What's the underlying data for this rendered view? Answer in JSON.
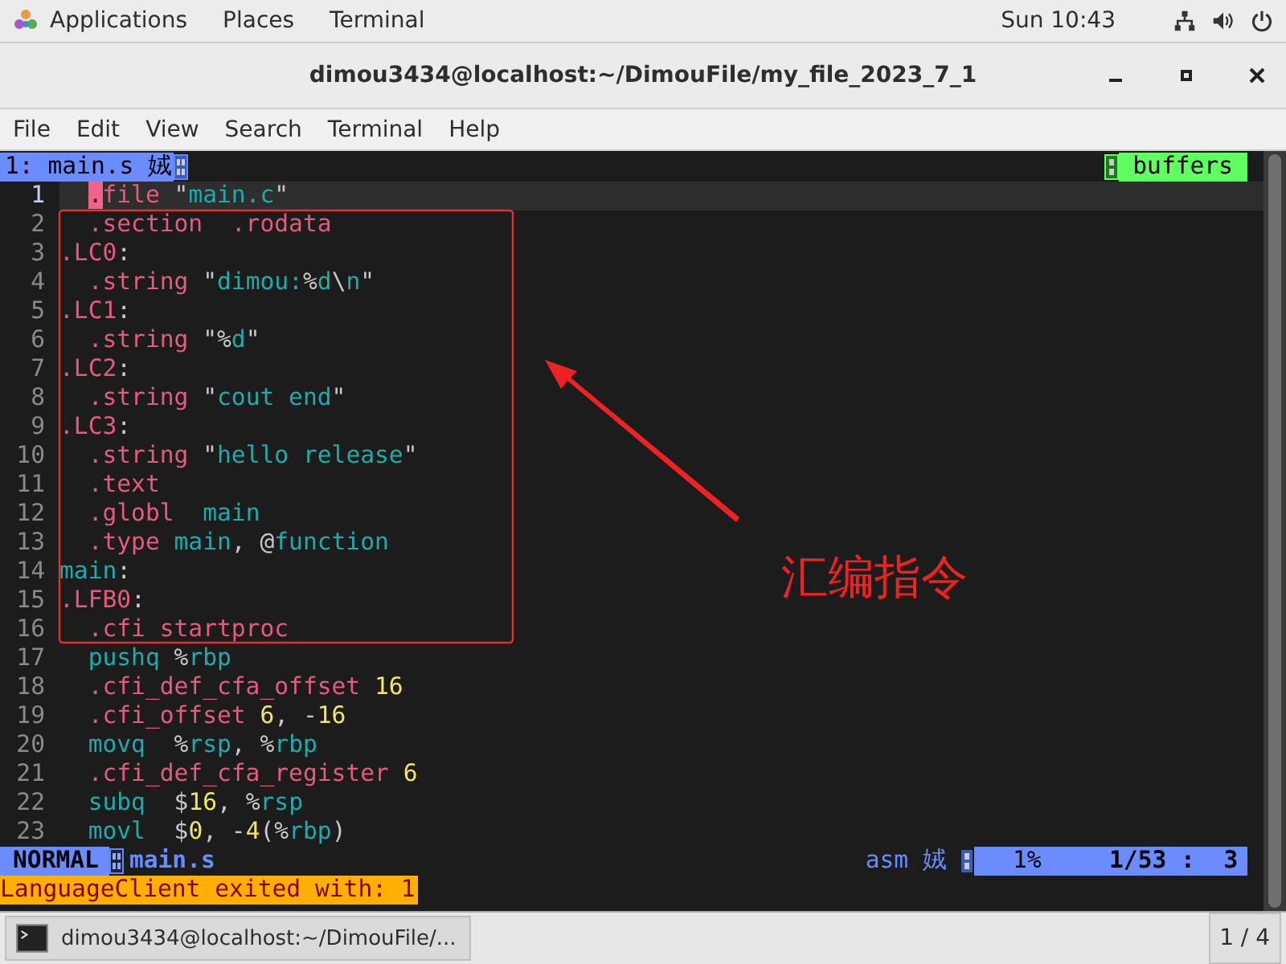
{
  "top_bar": {
    "menus": [
      "Applications",
      "Places",
      "Terminal"
    ],
    "clock": "Sun 10:43"
  },
  "window": {
    "title": "dimou3434@localhost:~/DimouFile/my_file_2023_7_1"
  },
  "menu_bar": [
    "File",
    "Edit",
    "View",
    "Search",
    "Terminal",
    "Help"
  ],
  "tabline": {
    "tab": "1: main.s 娀",
    "right": "buffers"
  },
  "lines": [
    {
      "num": "1",
      "current": true,
      "indent": true,
      "segs": [
        {
          "t": ".",
          "kind": "cursor"
        },
        {
          "t": "file ",
          "kind": "keyword"
        },
        {
          "t": "\"",
          "kind": "plain"
        },
        {
          "t": "main.c",
          "kind": "string"
        },
        {
          "t": "\"",
          "kind": "plain"
        }
      ]
    },
    {
      "num": "2",
      "current": false,
      "indent": true,
      "segs": [
        {
          "t": ".section  .rodata",
          "kind": "keyword"
        }
      ]
    },
    {
      "num": "3",
      "current": false,
      "indent": false,
      "segs": [
        {
          "t": ".LC0",
          "kind": "keyword"
        },
        {
          "t": ":",
          "kind": "plain"
        }
      ]
    },
    {
      "num": "4",
      "current": false,
      "indent": true,
      "segs": [
        {
          "t": ".string ",
          "kind": "keyword"
        },
        {
          "t": "\"",
          "kind": "plain"
        },
        {
          "t": "dimou:",
          "kind": "string"
        },
        {
          "t": "%",
          "kind": "plain"
        },
        {
          "t": "d",
          "kind": "string"
        },
        {
          "t": "\\",
          "kind": "plain"
        },
        {
          "t": "n",
          "kind": "string"
        },
        {
          "t": "\"",
          "kind": "plain"
        }
      ]
    },
    {
      "num": "5",
      "current": false,
      "indent": false,
      "segs": [
        {
          "t": ".LC1",
          "kind": "keyword"
        },
        {
          "t": ":",
          "kind": "plain"
        }
      ]
    },
    {
      "num": "6",
      "current": false,
      "indent": true,
      "segs": [
        {
          "t": ".string ",
          "kind": "keyword"
        },
        {
          "t": "\"%",
          "kind": "plain"
        },
        {
          "t": "d",
          "kind": "string"
        },
        {
          "t": "\"",
          "kind": "plain"
        }
      ]
    },
    {
      "num": "7",
      "current": false,
      "indent": false,
      "segs": [
        {
          "t": ".LC2",
          "kind": "keyword"
        },
        {
          "t": ":",
          "kind": "plain"
        }
      ]
    },
    {
      "num": "8",
      "current": false,
      "indent": true,
      "segs": [
        {
          "t": ".string ",
          "kind": "keyword"
        },
        {
          "t": "\"",
          "kind": "plain"
        },
        {
          "t": "cout end",
          "kind": "string"
        },
        {
          "t": "\"",
          "kind": "plain"
        }
      ]
    },
    {
      "num": "9",
      "current": false,
      "indent": false,
      "segs": [
        {
          "t": ".LC3",
          "kind": "keyword"
        },
        {
          "t": ":",
          "kind": "plain"
        }
      ]
    },
    {
      "num": "10",
      "current": false,
      "indent": true,
      "segs": [
        {
          "t": ".string ",
          "kind": "keyword"
        },
        {
          "t": "\"",
          "kind": "plain"
        },
        {
          "t": "hello release",
          "kind": "string"
        },
        {
          "t": "\"",
          "kind": "plain"
        }
      ]
    },
    {
      "num": "11",
      "current": false,
      "indent": true,
      "segs": [
        {
          "t": ".text",
          "kind": "keyword"
        }
      ]
    },
    {
      "num": "12",
      "current": false,
      "indent": true,
      "segs": [
        {
          "t": ".globl  ",
          "kind": "keyword"
        },
        {
          "t": "main",
          "kind": "string"
        }
      ]
    },
    {
      "num": "13",
      "current": false,
      "indent": true,
      "segs": [
        {
          "t": ".type ",
          "kind": "keyword"
        },
        {
          "t": "main",
          "kind": "string"
        },
        {
          "t": ", @",
          "kind": "plain"
        },
        {
          "t": "function",
          "kind": "string"
        }
      ]
    },
    {
      "num": "14",
      "current": false,
      "indent": false,
      "segs": [
        {
          "t": "main",
          "kind": "string"
        },
        {
          "t": ":",
          "kind": "plain"
        }
      ]
    },
    {
      "num": "15",
      "current": false,
      "indent": false,
      "segs": [
        {
          "t": ".LFB0",
          "kind": "keyword"
        },
        {
          "t": ":",
          "kind": "plain"
        }
      ]
    },
    {
      "num": "16",
      "current": false,
      "indent": true,
      "segs": [
        {
          "t": ".cfi startproc",
          "kind": "keyword"
        }
      ]
    },
    {
      "num": "17",
      "current": false,
      "indent": true,
      "segs": [
        {
          "t": "pushq ",
          "kind": "string"
        },
        {
          "t": "%",
          "kind": "plain"
        },
        {
          "t": "rbp",
          "kind": "string"
        }
      ]
    },
    {
      "num": "18",
      "current": false,
      "indent": true,
      "segs": [
        {
          "t": ".cfi_def_cfa_offset ",
          "kind": "keyword"
        },
        {
          "t": "16",
          "kind": "number"
        }
      ]
    },
    {
      "num": "19",
      "current": false,
      "indent": true,
      "segs": [
        {
          "t": ".cfi_offset ",
          "kind": "keyword"
        },
        {
          "t": "6",
          "kind": "number"
        },
        {
          "t": ", -",
          "kind": "plain"
        },
        {
          "t": "16",
          "kind": "number"
        }
      ]
    },
    {
      "num": "20",
      "current": false,
      "indent": true,
      "segs": [
        {
          "t": "movq  ",
          "kind": "string"
        },
        {
          "t": "%",
          "kind": "plain"
        },
        {
          "t": "rsp",
          "kind": "string"
        },
        {
          "t": ", %",
          "kind": "plain"
        },
        {
          "t": "rbp",
          "kind": "string"
        }
      ]
    },
    {
      "num": "21",
      "current": false,
      "indent": true,
      "segs": [
        {
          "t": ".cfi_def_cfa_register ",
          "kind": "keyword"
        },
        {
          "t": "6",
          "kind": "number"
        }
      ]
    },
    {
      "num": "22",
      "current": false,
      "indent": true,
      "segs": [
        {
          "t": "subq  ",
          "kind": "string"
        },
        {
          "t": "$",
          "kind": "plain"
        },
        {
          "t": "16",
          "kind": "number"
        },
        {
          "t": ", %",
          "kind": "plain"
        },
        {
          "t": "rsp",
          "kind": "string"
        }
      ]
    },
    {
      "num": "23",
      "current": false,
      "indent": true,
      "segs": [
        {
          "t": "movl  ",
          "kind": "string"
        },
        {
          "t": "$",
          "kind": "plain"
        },
        {
          "t": "0",
          "kind": "number"
        },
        {
          "t": ", -",
          "kind": "plain"
        },
        {
          "t": "4",
          "kind": "number"
        },
        {
          "t": "(%",
          "kind": "plain"
        },
        {
          "t": "rbp",
          "kind": "string"
        },
        {
          "t": ")",
          "kind": "plain"
        }
      ]
    }
  ],
  "status_line": {
    "mode": "NORMAL",
    "file": "main.s",
    "filetype": "asm 娀",
    "percent": "1%",
    "position": "1/53 :  3"
  },
  "message": "LanguageClient exited with: 1",
  "annotation": {
    "label": "汇编指令"
  },
  "taskbar": {
    "task": "dimou3434@localhost:~/DimouFile/...",
    "workspace": "1 / 4"
  }
}
